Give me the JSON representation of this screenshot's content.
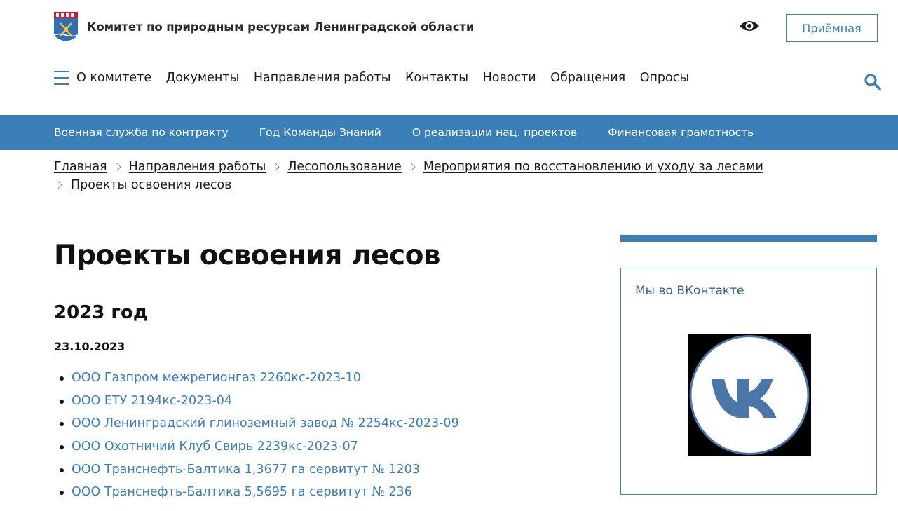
{
  "header": {
    "site_title": "Комитет по природным ресурсам Ленинградской области",
    "accessibility_icon": "eye-icon",
    "reception_label": "Приёмная"
  },
  "main_nav": {
    "menu_icon": "hamburger-menu-icon",
    "items": [
      "О комитете",
      "Документы",
      "Направления работы",
      "Контакты",
      "Новости",
      "Обращения",
      "Опросы"
    ],
    "search_icon": "search-icon"
  },
  "topic_bar": {
    "items": [
      "Военная служба по контракту",
      "Год Команды Знаний",
      "О реализации нац. проектов",
      "Финансовая грамотность"
    ]
  },
  "breadcrumb": {
    "items": [
      "Главная",
      "Направления работы",
      "Лесопользование",
      "Мероприятия по восстановлению и уходу за лесами",
      "Проекты освоения лесов"
    ]
  },
  "content": {
    "page_title": "Проекты освоения лесов",
    "year_heading": "2023 год",
    "date_heading": "23.10.2023",
    "documents": [
      "ООО Газпром межрегионгаз 2260кс-2023-10",
      "ООО ЕТУ 2194кс-2023-04",
      "ООО Ленинградский глиноземный завод № 2254кс-2023-09",
      "ООО Охотничий Клуб Свирь 2239кс-2023-07",
      "ООО Транснефть-Балтика 1,3677 га сервитут № 1203",
      "ООО Транснефть-Балтика 5,5695 га сервитут № 236"
    ]
  },
  "sidebar": {
    "vk_title": "Мы во ВКонтакте",
    "vk_logo_icon": "vk-logo-icon"
  },
  "colors": {
    "brand_blue": "#3a7fb8",
    "vk_blue": "#4a76a8",
    "text": "#1a1a1a"
  }
}
